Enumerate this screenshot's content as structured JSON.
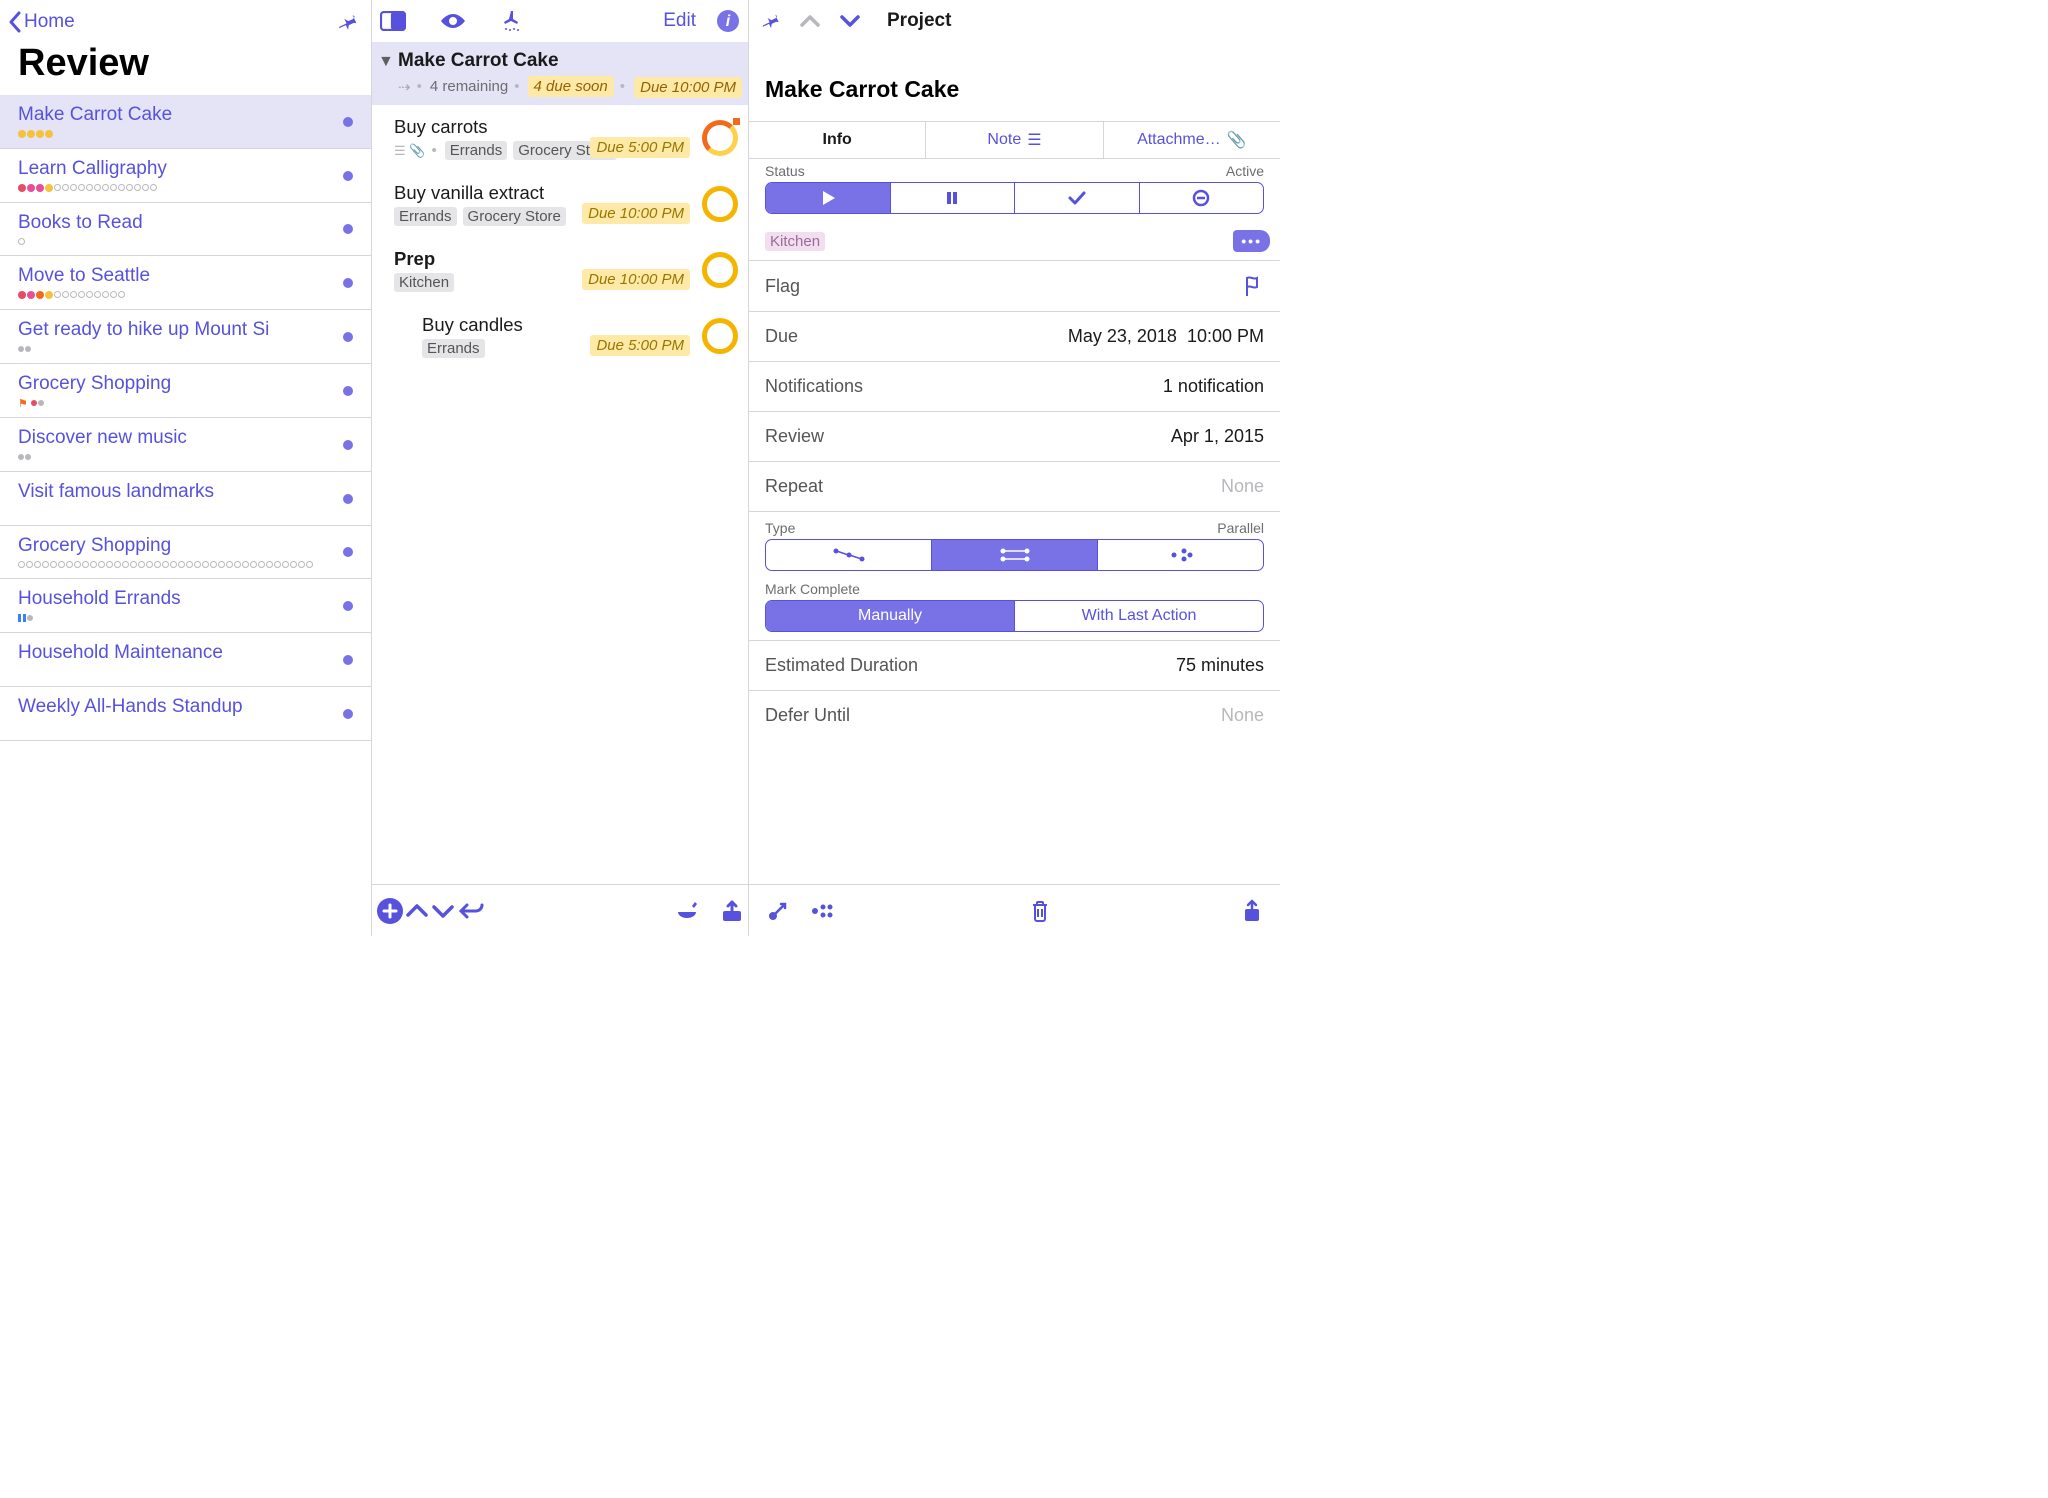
{
  "sidebar": {
    "back_label": "Home",
    "title": "Review",
    "projects": [
      {
        "name": "Make Carrot Cake",
        "dots": [
          "yel",
          "yel",
          "yel",
          "yel"
        ],
        "selected": true
      },
      {
        "name": "Learn Calligraphy",
        "dots": [
          "red",
          "mag",
          "mag",
          "yel",
          "out",
          "out",
          "out",
          "out",
          "out",
          "out",
          "out",
          "out",
          "out",
          "out",
          "out",
          "out",
          "out"
        ]
      },
      {
        "name": "Books to Read",
        "dots": [
          "out"
        ]
      },
      {
        "name": "Move to Seattle",
        "dots": [
          "red",
          "mag",
          "org",
          "yel",
          "out",
          "out",
          "out",
          "out",
          "out",
          "out",
          "out",
          "out",
          "out"
        ]
      },
      {
        "name": "Get ready to hike up Mount Si",
        "mini": [
          {
            "t": "dot"
          },
          {
            "t": "dot"
          }
        ]
      },
      {
        "name": "Grocery Shopping",
        "mini": [
          {
            "t": "flag"
          },
          {
            "t": "dot",
            "c": "red"
          },
          {
            "t": "dot"
          }
        ]
      },
      {
        "name": "Discover new music",
        "mini": [
          {
            "t": "dot"
          },
          {
            "t": "dot"
          }
        ]
      },
      {
        "name": "Visit famous landmarks"
      },
      {
        "name": "Grocery Shopping",
        "dots": [
          "out",
          "out",
          "out",
          "out",
          "out",
          "out",
          "out",
          "out",
          "out",
          "out",
          "out",
          "out",
          "out",
          "out",
          "out",
          "out",
          "out",
          "out",
          "out",
          "out",
          "out",
          "out",
          "out",
          "out",
          "out",
          "out",
          "out",
          "out",
          "out",
          "out",
          "out",
          "out",
          "out",
          "out",
          "out",
          "out",
          "out"
        ]
      },
      {
        "name": "Household Errands",
        "mini": [
          {
            "t": "pause"
          },
          {
            "t": "dot"
          }
        ]
      },
      {
        "name": "Household Maintenance"
      },
      {
        "name": "Weekly All-Hands Standup"
      }
    ]
  },
  "tasks": {
    "edit_label": "Edit",
    "header": {
      "name": "Make Carrot Cake",
      "remaining": "4 remaining",
      "due_soon": "4 due soon",
      "due_badge": "Due 10:00 PM"
    },
    "items": [
      {
        "name": "Buy carrots",
        "tags": [
          "Errands",
          "Grocery Store"
        ],
        "due": "Due 5:00 PM",
        "circle": "orange-grad",
        "icons": true
      },
      {
        "name": "Buy vanilla extract",
        "tags": [
          "Errands",
          "Grocery Store"
        ],
        "due": "Due 10:00 PM",
        "circle": "amber"
      },
      {
        "name": "Prep",
        "tags": [
          "Kitchen"
        ],
        "due": "Due 10:00 PM",
        "circle": "amber",
        "bold": true
      },
      {
        "name": "Buy candles",
        "tags": [
          "Errands"
        ],
        "due": "Due 5:00 PM",
        "circle": "amber",
        "indent": true
      }
    ]
  },
  "inspector": {
    "header_label": "Project",
    "name": "Make Carrot Cake",
    "tabs": {
      "info": "Info",
      "note": "Note",
      "attach": "Attachme…"
    },
    "status": {
      "label": "Status",
      "value": "Active"
    },
    "tag": "Kitchen",
    "rows": {
      "flag": {
        "k": "Flag"
      },
      "due": {
        "k": "Due",
        "date": "May 23, 2018",
        "time": "10:00 PM"
      },
      "notifications": {
        "k": "Notifications",
        "v": "1 notification"
      },
      "review": {
        "k": "Review",
        "v": "Apr 1, 2015"
      },
      "repeat": {
        "k": "Repeat",
        "v": "None",
        "dim": true
      }
    },
    "type": {
      "label": "Type",
      "value": "Parallel"
    },
    "mark": {
      "label": "Mark Complete",
      "manually": "Manually",
      "last": "With Last Action"
    },
    "duration": {
      "k": "Estimated Duration",
      "v": "75 minutes"
    },
    "defer": {
      "k": "Defer Until",
      "v": "None",
      "dim": true
    }
  }
}
